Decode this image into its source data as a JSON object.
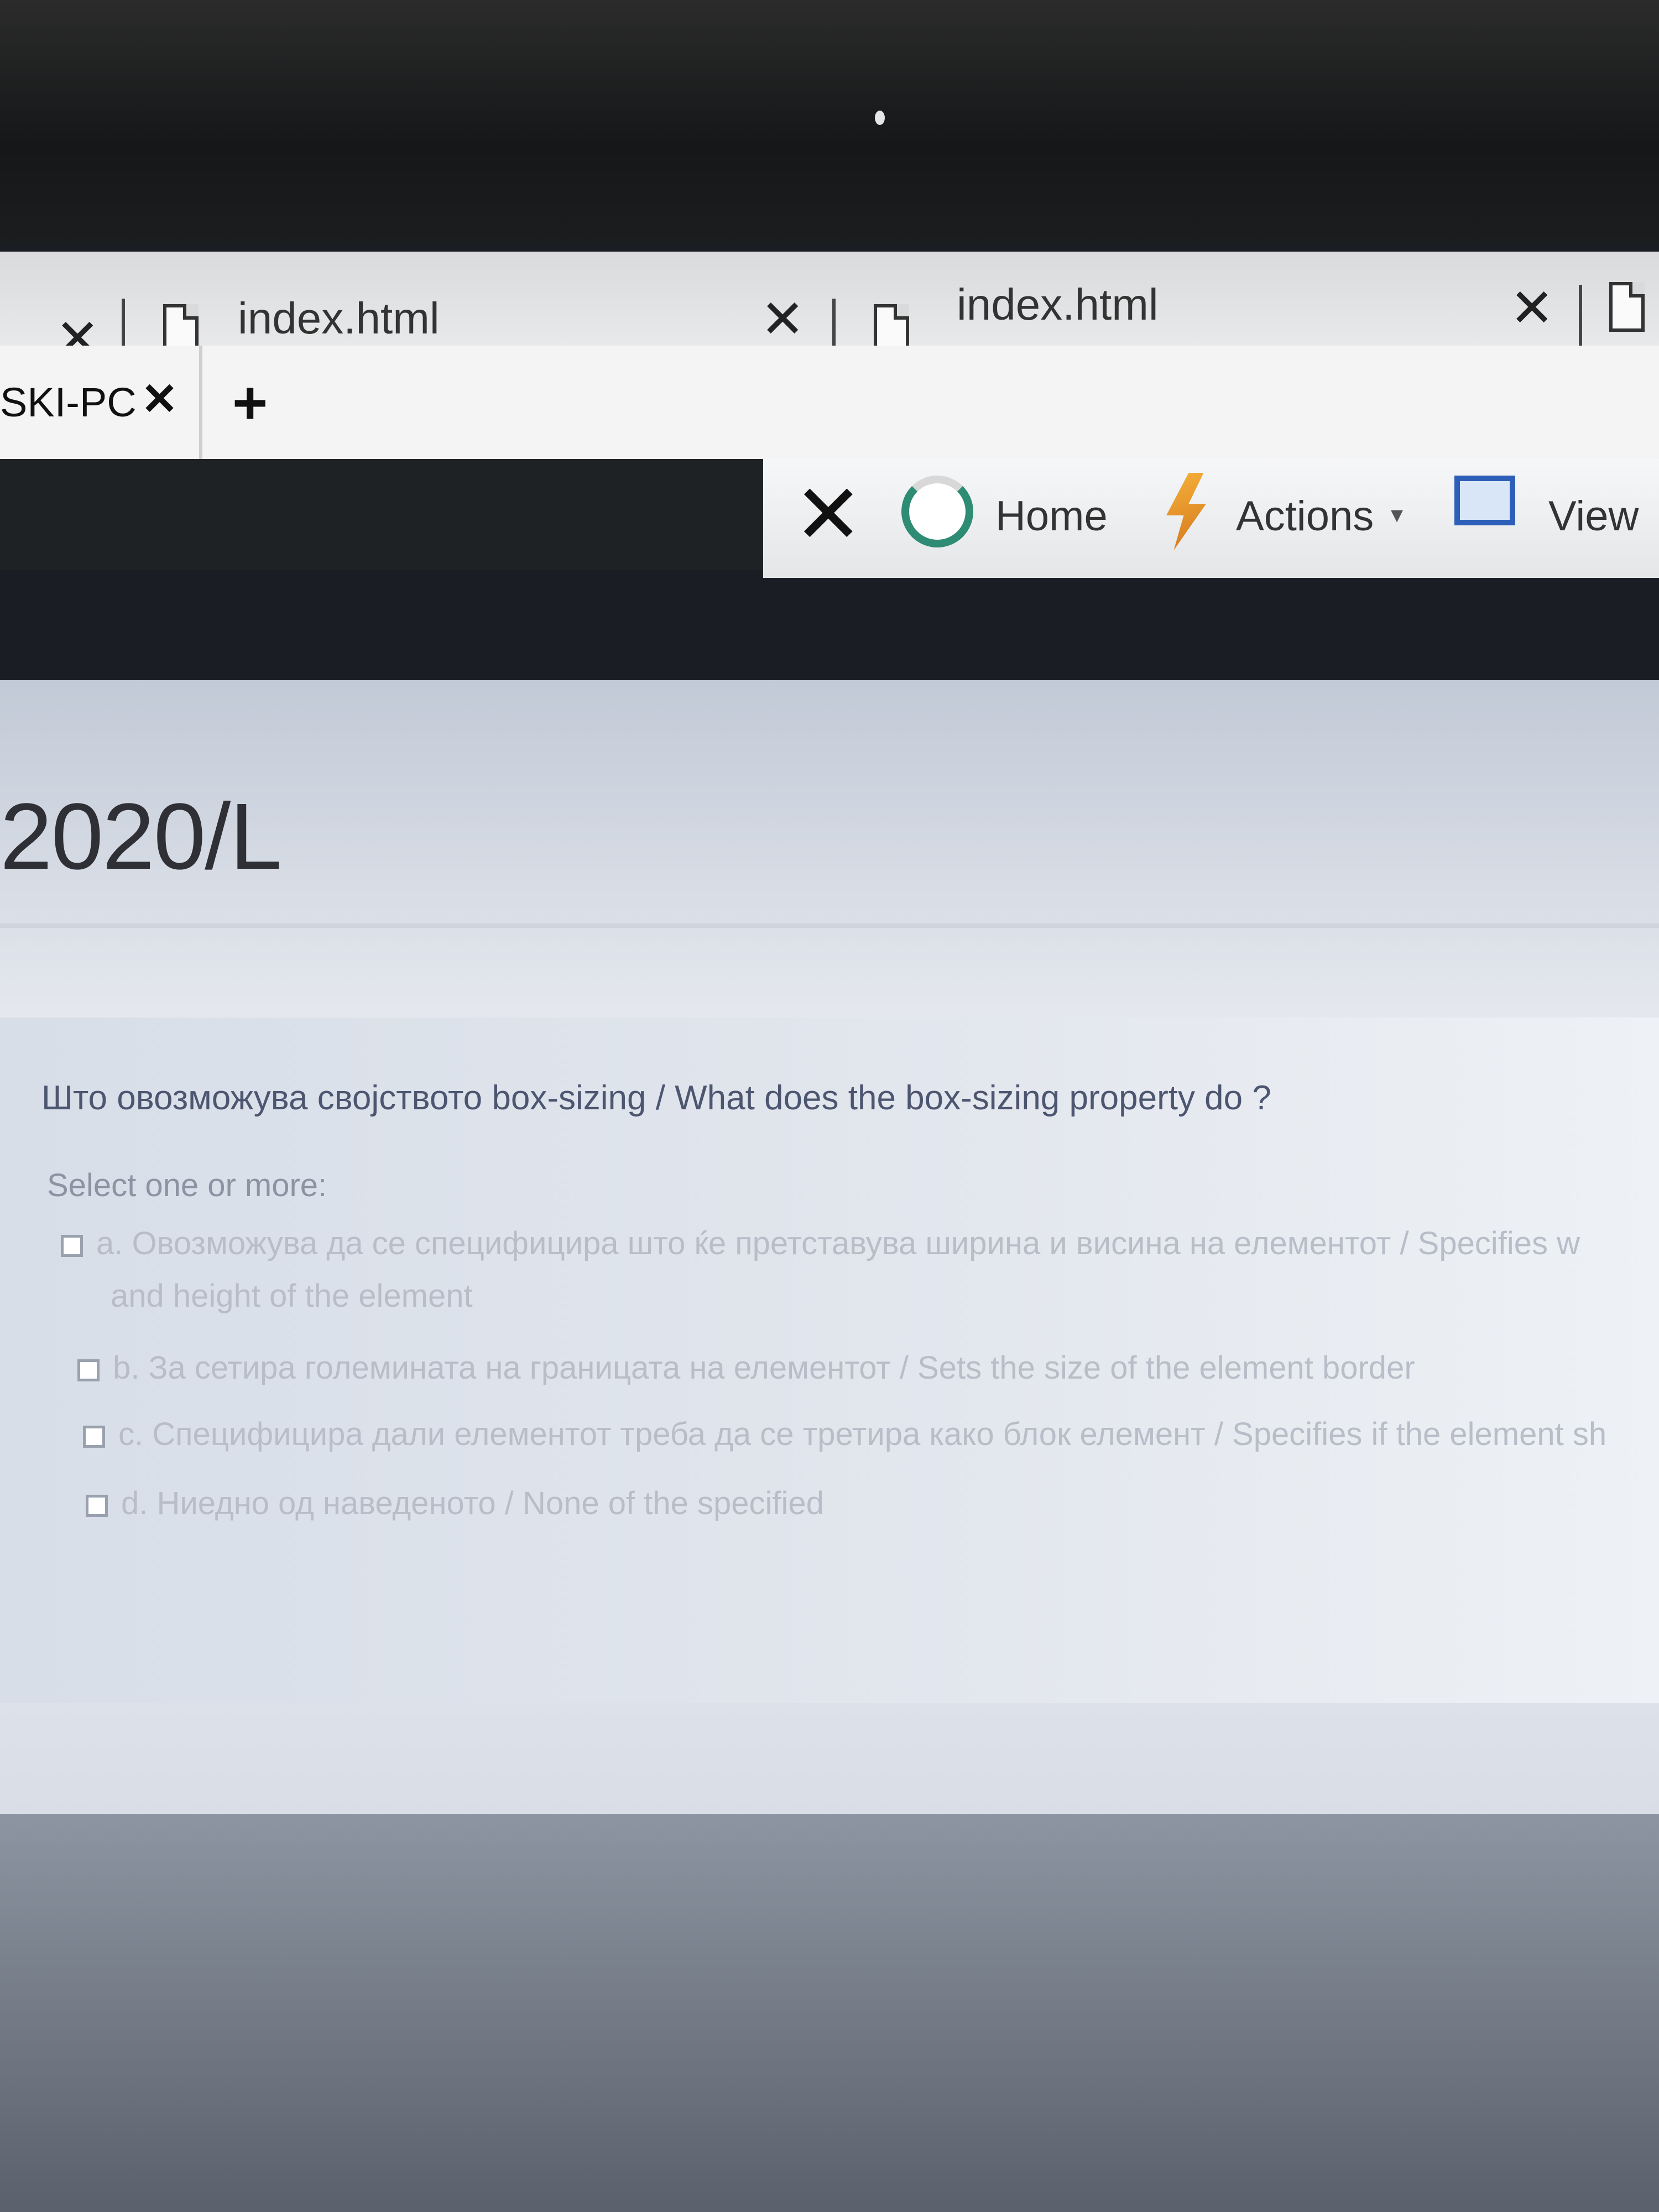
{
  "tabs": [
    {
      "title": "index.html"
    },
    {
      "title": "index.html"
    }
  ],
  "session_tab": {
    "label": "SKI-PC",
    "close": "✕"
  },
  "new_tab": "+",
  "toolbar": {
    "close": "✕",
    "home": "Home",
    "actions": "Actions",
    "view": "View",
    "caret": "▾"
  },
  "page": {
    "headline": "2020/L",
    "question": "Што овозможува својството box-sizing / What does the box-sizing property do ?",
    "hint": "Select one or more:",
    "options": [
      {
        "text": "a. Овозможува да се специфицира што ќе претставува ширина и висина на елементот / Specifies w",
        "cont": "and height of the element"
      },
      {
        "text": "b. За сетира големината на границата на елементот / Sets the size of the element border"
      },
      {
        "text": "c. Специфицира дали елементот треба да се третира како блок елемент / Specifies if the element sh"
      },
      {
        "text": "d. Ниедно од наведеното / None of the specified"
      }
    ]
  }
}
